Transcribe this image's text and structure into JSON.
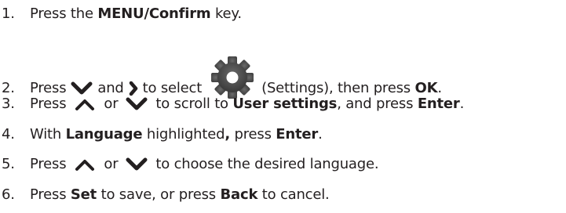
{
  "steps": [
    {
      "num": "1.",
      "parts": [
        "Press the ",
        "MENU/Confirm",
        " key."
      ]
    },
    {
      "num": "2.",
      "parts": [
        "Press",
        "and",
        "to select",
        "(Settings), then press ",
        "OK",
        "."
      ]
    },
    {
      "num": "3.",
      "parts": [
        "Press",
        "or",
        "to scroll to ",
        "User settings",
        ", and press ",
        "Enter",
        "."
      ]
    },
    {
      "num": "4.",
      "parts": [
        "With ",
        "Language",
        " highlighted",
        ",",
        " press ",
        "Enter",
        "."
      ]
    },
    {
      "num": "5.",
      "parts": [
        "Press",
        "or",
        "to choose the desired language."
      ]
    },
    {
      "num": "6.",
      "parts": [
        "Press ",
        "Set",
        " to save, or press ",
        "Back",
        " to cancel."
      ]
    }
  ],
  "icons": {
    "down": "chevron-down-icon",
    "right": "chevron-right-icon",
    "up": "chevron-up-icon",
    "settings": "gear-icon"
  },
  "colors": {
    "text": "#231f20",
    "icon": "#231f20",
    "gear": "#4a4a4a"
  }
}
